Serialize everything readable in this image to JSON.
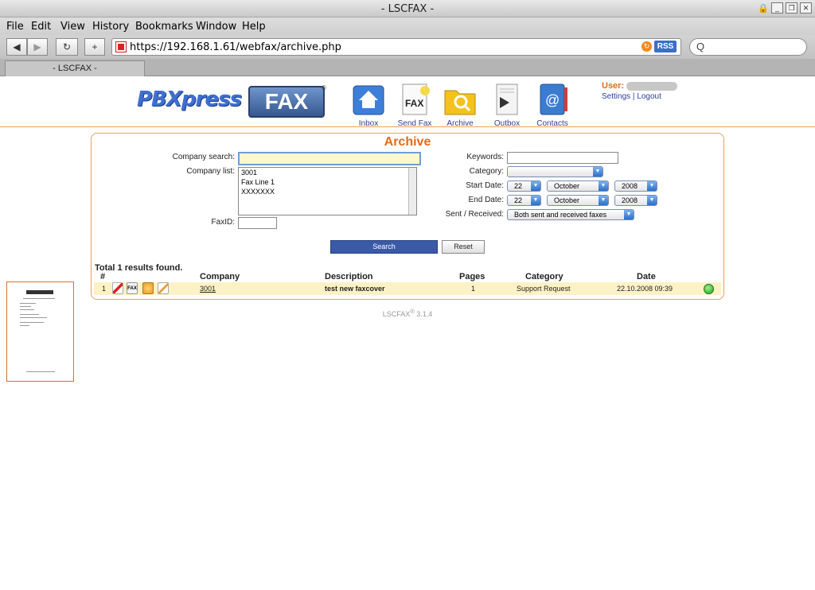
{
  "window": {
    "title": "- LSCFAX -"
  },
  "menu": [
    "File",
    "Edit",
    "View",
    "History",
    "Bookmarks",
    "Window",
    "Help"
  ],
  "toolbar": {
    "url": "https://192.168.1.61/webfax/archive.php",
    "rss_label": "RSS",
    "search_placeholder": "Q"
  },
  "tab": {
    "label": "- LSCFAX -"
  },
  "header": {
    "nav": [
      {
        "label": "Inbox",
        "icon": "inbox-icon"
      },
      {
        "label": "Send Fax",
        "icon": "send-fax-icon"
      },
      {
        "label": "Archive",
        "icon": "archive-icon"
      },
      {
        "label": "Outbox",
        "icon": "outbox-icon"
      },
      {
        "label": "Contacts",
        "icon": "contacts-icon"
      }
    ],
    "user_label": "User:",
    "settings": "Settings",
    "separator": "|",
    "logout": "Logout"
  },
  "archive": {
    "title": "Archive",
    "company_search_label": "Company search:",
    "company_search_value": "",
    "company_list_label": "Company list:",
    "company_list": [
      "3001",
      "Fax Line 1",
      "XXXXXXX"
    ],
    "faxid_label": "FaxID:",
    "keywords_label": "Keywords:",
    "category_label": "Category:",
    "category_value": "",
    "start_date_label": "Start Date:",
    "start_day": "22",
    "start_month": "October",
    "start_year": "2008",
    "end_date_label": "End Date:",
    "end_day": "22",
    "end_month": "October",
    "end_year": "2008",
    "sent_received_label": "Sent / Received:",
    "sent_received_value": "Both sent and received faxes",
    "search_button": "Search",
    "reset_button": "Reset"
  },
  "results": {
    "summary": "Total 1 results found.",
    "columns": [
      "#",
      "Company",
      "Description",
      "Pages",
      "Category",
      "Date"
    ],
    "rows": [
      {
        "num": "1",
        "company": "3001",
        "description": "test new faxcover",
        "pages": "1",
        "category": "Support Request",
        "date": "22.10.2008 09:39"
      }
    ]
  },
  "footer": {
    "text": "LSCFAX",
    "sup": "®",
    "version": "3.1.4"
  },
  "colors": {
    "accent_orange": "#e86a10",
    "nav_blue": "#2b3f9a",
    "row_highlight": "#fdf2c6",
    "search_button": "#3a5aa8"
  }
}
